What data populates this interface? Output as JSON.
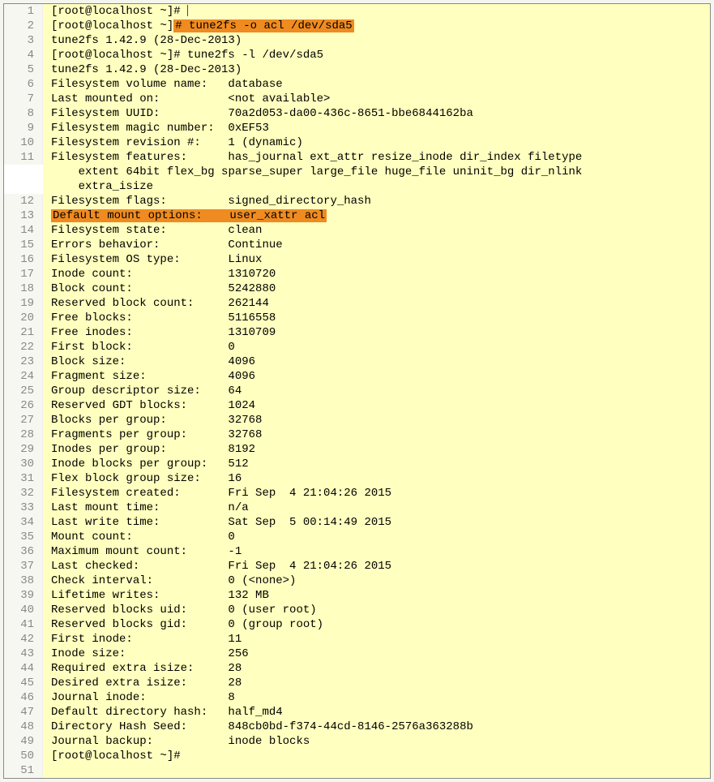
{
  "lines": [
    {
      "n": 1,
      "pre": "[root@localhost ~]# ",
      "hl": "",
      "post": "",
      "cursor": true
    },
    {
      "n": 2,
      "pre": "[root@localhost ~]",
      "hl": "# tune2fs -o acl /dev/sda5",
      "post": ""
    },
    {
      "n": 3,
      "pre": "tune2fs 1.42.9 (28-Dec-2013)",
      "hl": "",
      "post": ""
    },
    {
      "n": 4,
      "pre": "[root@localhost ~]# tune2fs -l /dev/sda5",
      "hl": "",
      "post": ""
    },
    {
      "n": 5,
      "pre": "tune2fs 1.42.9 (28-Dec-2013)",
      "hl": "",
      "post": ""
    },
    {
      "n": 6,
      "pre": "Filesystem volume name:   database",
      "hl": "",
      "post": ""
    },
    {
      "n": 7,
      "pre": "Last mounted on:          <not available>",
      "hl": "",
      "post": ""
    },
    {
      "n": 8,
      "pre": "Filesystem UUID:          70a2d053-da00-436c-8651-bbe6844162ba",
      "hl": "",
      "post": ""
    },
    {
      "n": 9,
      "pre": "Filesystem magic number:  0xEF53",
      "hl": "",
      "post": ""
    },
    {
      "n": 10,
      "pre": "Filesystem revision #:    1 (dynamic)",
      "hl": "",
      "post": ""
    },
    {
      "n": 11,
      "pre": "Filesystem features:      has_journal ext_attr resize_inode dir_index filetype\n    extent 64bit flex_bg sparse_super large_file huge_file uninit_bg dir_nlink\n    extra_isize",
      "hl": "",
      "post": "",
      "wrap": true
    },
    {
      "n": 12,
      "pre": "Filesystem flags:         signed_directory_hash",
      "hl": "",
      "post": ""
    },
    {
      "n": 13,
      "pre": "",
      "hl": "Default mount options:    user_xattr acl",
      "post": ""
    },
    {
      "n": 14,
      "pre": "Filesystem state:         clean",
      "hl": "",
      "post": ""
    },
    {
      "n": 15,
      "pre": "Errors behavior:          Continue",
      "hl": "",
      "post": ""
    },
    {
      "n": 16,
      "pre": "Filesystem OS type:       Linux",
      "hl": "",
      "post": ""
    },
    {
      "n": 17,
      "pre": "Inode count:              1310720",
      "hl": "",
      "post": ""
    },
    {
      "n": 18,
      "pre": "Block count:              5242880",
      "hl": "",
      "post": ""
    },
    {
      "n": 19,
      "pre": "Reserved block count:     262144",
      "hl": "",
      "post": ""
    },
    {
      "n": 20,
      "pre": "Free blocks:              5116558",
      "hl": "",
      "post": ""
    },
    {
      "n": 21,
      "pre": "Free inodes:              1310709",
      "hl": "",
      "post": ""
    },
    {
      "n": 22,
      "pre": "First block:              0",
      "hl": "",
      "post": ""
    },
    {
      "n": 23,
      "pre": "Block size:               4096",
      "hl": "",
      "post": ""
    },
    {
      "n": 24,
      "pre": "Fragment size:            4096",
      "hl": "",
      "post": ""
    },
    {
      "n": 25,
      "pre": "Group descriptor size:    64",
      "hl": "",
      "post": ""
    },
    {
      "n": 26,
      "pre": "Reserved GDT blocks:      1024",
      "hl": "",
      "post": ""
    },
    {
      "n": 27,
      "pre": "Blocks per group:         32768",
      "hl": "",
      "post": ""
    },
    {
      "n": 28,
      "pre": "Fragments per group:      32768",
      "hl": "",
      "post": ""
    },
    {
      "n": 29,
      "pre": "Inodes per group:         8192",
      "hl": "",
      "post": ""
    },
    {
      "n": 30,
      "pre": "Inode blocks per group:   512",
      "hl": "",
      "post": ""
    },
    {
      "n": 31,
      "pre": "Flex block group size:    16",
      "hl": "",
      "post": ""
    },
    {
      "n": 32,
      "pre": "Filesystem created:       Fri Sep  4 21:04:26 2015",
      "hl": "",
      "post": ""
    },
    {
      "n": 33,
      "pre": "Last mount time:          n/a",
      "hl": "",
      "post": ""
    },
    {
      "n": 34,
      "pre": "Last write time:          Sat Sep  5 00:14:49 2015",
      "hl": "",
      "post": ""
    },
    {
      "n": 35,
      "pre": "Mount count:              0",
      "hl": "",
      "post": ""
    },
    {
      "n": 36,
      "pre": "Maximum mount count:      -1",
      "hl": "",
      "post": ""
    },
    {
      "n": 37,
      "pre": "Last checked:             Fri Sep  4 21:04:26 2015",
      "hl": "",
      "post": ""
    },
    {
      "n": 38,
      "pre": "Check interval:           0 (<none>)",
      "hl": "",
      "post": ""
    },
    {
      "n": 39,
      "pre": "Lifetime writes:          132 MB",
      "hl": "",
      "post": ""
    },
    {
      "n": 40,
      "pre": "Reserved blocks uid:      0 (user root)",
      "hl": "",
      "post": ""
    },
    {
      "n": 41,
      "pre": "Reserved blocks gid:      0 (group root)",
      "hl": "",
      "post": ""
    },
    {
      "n": 42,
      "pre": "First inode:              11",
      "hl": "",
      "post": ""
    },
    {
      "n": 43,
      "pre": "Inode size:\t          256",
      "hl": "",
      "post": ""
    },
    {
      "n": 44,
      "pre": "Required extra isize:     28",
      "hl": "",
      "post": ""
    },
    {
      "n": 45,
      "pre": "Desired extra isize:      28",
      "hl": "",
      "post": ""
    },
    {
      "n": 46,
      "pre": "Journal inode:            8",
      "hl": "",
      "post": ""
    },
    {
      "n": 47,
      "pre": "Default directory hash:   half_md4",
      "hl": "",
      "post": ""
    },
    {
      "n": 48,
      "pre": "Directory Hash Seed:      848cb0bd-f374-44cd-8146-2576a363288b",
      "hl": "",
      "post": ""
    },
    {
      "n": 49,
      "pre": "Journal backup:           inode blocks",
      "hl": "",
      "post": ""
    },
    {
      "n": 50,
      "pre": "[root@localhost ~]# ",
      "hl": "",
      "post": ""
    },
    {
      "n": 51,
      "pre": "",
      "hl": "",
      "post": ""
    }
  ],
  "wrap_glyph": "↵"
}
